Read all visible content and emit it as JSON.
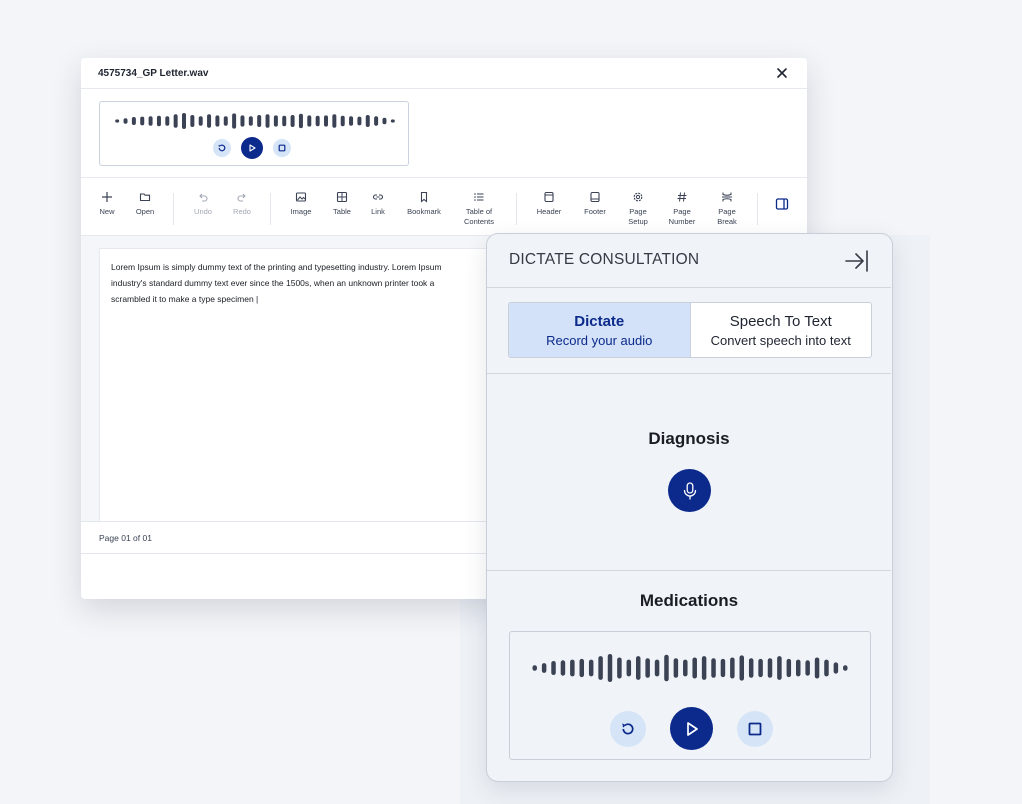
{
  "editor": {
    "file_name": "4575734_GP Letter.wav",
    "toolbar": [
      {
        "label": "New",
        "icon": "plus-icon",
        "enabled": true
      },
      {
        "label": "Open",
        "icon": "folder-icon",
        "enabled": true
      },
      {
        "label": "Undo",
        "icon": "undo-icon",
        "enabled": false
      },
      {
        "label": "Redo",
        "icon": "redo-icon",
        "enabled": false
      },
      {
        "label": "Image",
        "icon": "image-icon",
        "enabled": true
      },
      {
        "label": "Table",
        "icon": "table-icon",
        "enabled": true
      },
      {
        "label": "Link",
        "icon": "link-icon",
        "enabled": true
      },
      {
        "label": "Bookmark",
        "icon": "bookmark-icon",
        "enabled": true
      },
      {
        "label": "Table of\nContents",
        "icon": "list-icon",
        "enabled": true
      },
      {
        "label": "Header",
        "icon": "header-icon",
        "enabled": true
      },
      {
        "label": "Footer",
        "icon": "footer-icon",
        "enabled": true
      },
      {
        "label": "Page\nSetup",
        "icon": "gear-icon",
        "enabled": true
      },
      {
        "label": "Page\nNumber",
        "icon": "hash-icon",
        "enabled": true
      },
      {
        "label": "Page\nBreak",
        "icon": "page-break-icon",
        "enabled": true
      }
    ],
    "document_text": "Lorem Ipsum is simply dummy text of the printing and typesetting industry. Lorem Ipsum\nindustry's standard dummy text ever since the 1500s, when an unknown printer took a\nscrambled it to make a type specimen |",
    "page_info": "Page 01 of 01"
  },
  "dictate_panel": {
    "title": "DICTATE CONSULTATION",
    "modes": [
      {
        "title": "Dictate",
        "subtitle": "Record your audio",
        "active": true
      },
      {
        "title": "Speech To Text",
        "subtitle": "Convert speech into text",
        "active": false
      }
    ],
    "sections": [
      {
        "label": "Diagnosis"
      },
      {
        "label": "Medications"
      }
    ]
  },
  "colors": {
    "accent": "#0b2a8c",
    "accent_light": "#d6e4f7",
    "active_tab_bg": "#d3e2f8",
    "wave": "#3a4254"
  }
}
